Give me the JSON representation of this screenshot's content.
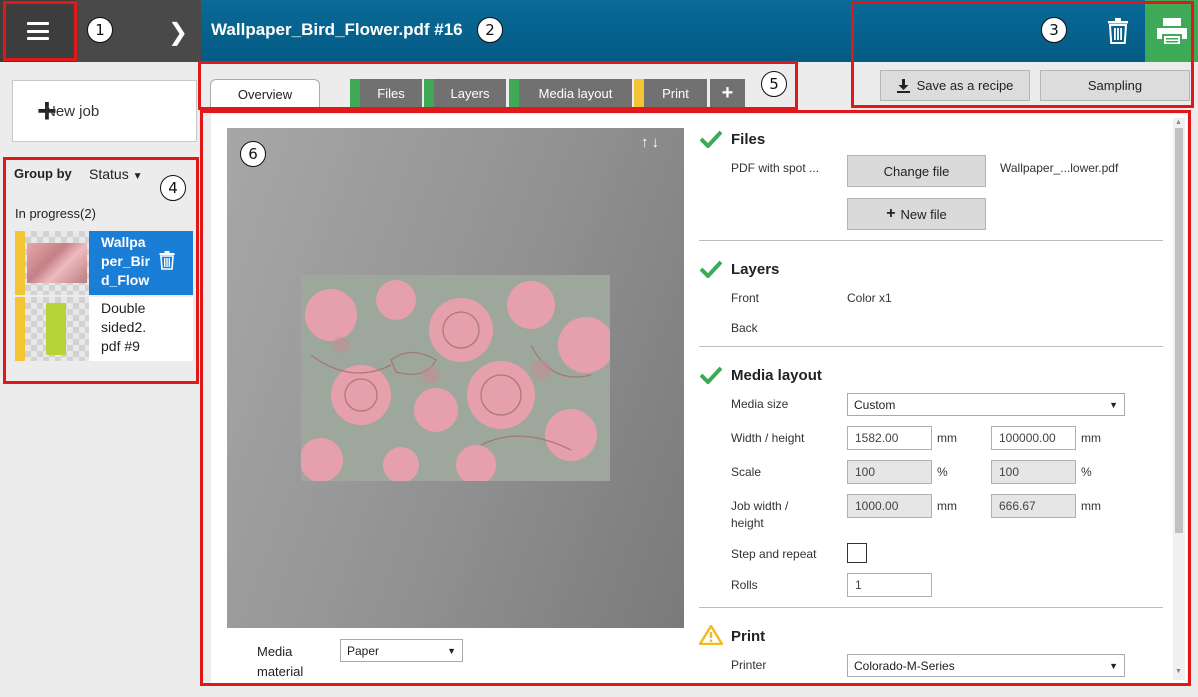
{
  "header": {
    "job_title": "Wallpaper_Bird_Flower.pdf #16",
    "colors": {
      "bar": "#0a6a98",
      "print_button": "#3ea957",
      "menu_button": "#3d3d3d"
    }
  },
  "callouts": [
    "1",
    "2",
    "3",
    "4",
    "5",
    "6"
  ],
  "sidebar": {
    "new_job_label": "New job",
    "group_by_label": "Group by",
    "group_by_value": "Status",
    "group_title": "In progress(2)",
    "jobs": [
      {
        "name": "Wallpa\nper_Bir\nd_Flow",
        "selected": true,
        "status_color": "#f3c534"
      },
      {
        "name": "Double\nsided2.\npdf #9",
        "selected": false,
        "status_color": "#f3c534"
      }
    ]
  },
  "tabs": [
    {
      "label": "Overview",
      "status_color": ""
    },
    {
      "label": "Files",
      "status_color": "#3ea957"
    },
    {
      "label": "Layers",
      "status_color": "#3ea957"
    },
    {
      "label": "Media layout",
      "status_color": "#3ea957"
    },
    {
      "label": "Print",
      "status_color": "#f3c534"
    }
  ],
  "toolbar": {
    "save_recipe_label": "Save as a recipe",
    "sampling_label": "Sampling"
  },
  "preview": {
    "media_material_label": "Media\nmaterial",
    "media_material_value": "Paper"
  },
  "files": {
    "title": "Files",
    "file_label": "PDF with spot ...",
    "change_file_label": "Change file",
    "file_name": "Wallpaper_...lower.pdf",
    "new_file_label": "New file"
  },
  "layers": {
    "title": "Layers",
    "front_label": "Front",
    "front_value": "Color x1",
    "back_label": "Back"
  },
  "media_layout": {
    "title": "Media layout",
    "media_size_label": "Media size",
    "media_size_value": "Custom",
    "width_height_label": "Width / height",
    "width_value": "1582.00",
    "height_value": "100000.00",
    "scale_label": "Scale",
    "scale_x": "100",
    "scale_y": "100",
    "job_wh_label": "Job width /\nheight",
    "job_width": "1000.00",
    "job_height": "666.67",
    "step_repeat_label": "Step and repeat",
    "rolls_label": "Rolls",
    "rolls_value": "1",
    "unit_mm": "mm",
    "unit_pct": "%"
  },
  "print": {
    "title": "Print",
    "printer_label": "Printer",
    "printer_value": "Colorado-M-Series"
  }
}
